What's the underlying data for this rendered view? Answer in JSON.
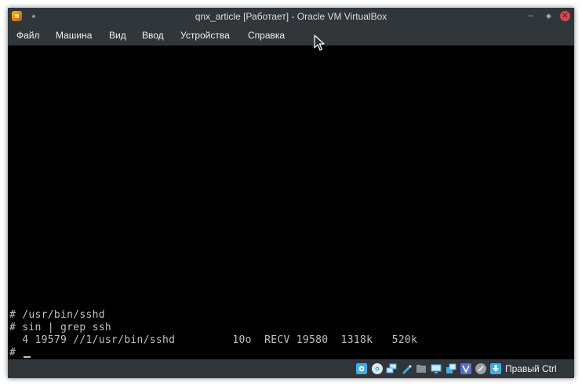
{
  "window": {
    "title": "qnx_article [Работает] - Oracle VM VirtualBox",
    "buttons": {
      "minimize": "–",
      "maximize": "◆",
      "close": "✕"
    }
  },
  "menu": [
    "Файл",
    "Машина",
    "Вид",
    "Ввод",
    "Устройства",
    "Справка"
  ],
  "terminal": {
    "lines": [
      "# /usr/bin/sshd",
      "# sin | grep ssh",
      "  4 19579 //1/usr/bin/sshd         10o  RECV 19580  1318k   520k",
      "# "
    ]
  },
  "statusbar": {
    "icons": [
      "hard-disk-icon",
      "optical-disk-icon",
      "audio-icon",
      "network-icon",
      "usb-icon",
      "shared-folders-icon",
      "display-icon",
      "video-capture-icon",
      "virtualization-icon",
      "mouse-integration-icon",
      "keyboard-icon"
    ],
    "host_key": "Правый Ctrl"
  },
  "colors": {
    "chrome": "#31363b",
    "screen": "#000000",
    "terminal_text": "#c0c0c0",
    "close_button": "#da4453",
    "status_icon_blue": "#3daee9"
  }
}
